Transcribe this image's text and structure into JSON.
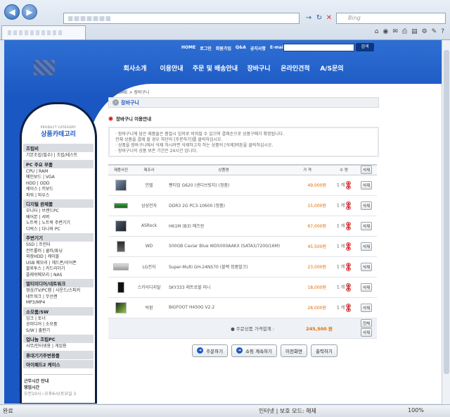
{
  "browser": {
    "search_placeholder": "Bing",
    "status_left": "완료",
    "status_zone": "인터넷 | 보호 모드: 해제",
    "zoom": "100%",
    "back_icon": "back-arrow-icon",
    "forward_icon": "forward-arrow-icon"
  },
  "site": {
    "top_links": [
      "HOME",
      "로그인",
      "회원가입",
      "Q&A",
      "공지사항",
      "E-mail"
    ],
    "search_button": "검색",
    "menu": [
      "회사소개",
      "이용안내",
      "주문 및 배송안내",
      "장바구니",
      "온라인견적",
      "A/S문의"
    ]
  },
  "sidebar": {
    "title_small": "PRODUCT CATEGORY",
    "title": "상품카테고리",
    "sections": [
      {
        "head": "조립비",
        "items": [
          "기본조립(필수) | 조립/테스트"
        ]
      },
      {
        "head": "PC 주요 부품",
        "items": [
          "CPU | RAM",
          "메인보드 | VGA",
          "HDD | ODD",
          "케이스 | 키보드",
          "파워 | 마우스"
        ]
      },
      {
        "head": "디지털 완제품",
        "items": [
          "모니터 | 브랜드PC",
          "베어본 | 서버",
          "노트북 | 노트북 주변기기",
          "디빅스 | 다나와 PC"
        ]
      },
      {
        "head": "주변기기",
        "items": [
          "SSD | 프린터",
          "컨트롤러 | 쿨러/튜닝",
          "외장HDD | 케이블",
          "USB 메모리 | 헤드폰/이어폰",
          "블루투스 | 카드리더기",
          "플레쉬메모리 | NAS"
        ]
      },
      {
        "head": "멀티미디어/네트워크",
        "items": [
          "영상/TV/PC캠 | 사운드/스피커",
          "네트워크 | 무선랜",
          "MP3/MP4"
        ]
      },
      {
        "head": "소모품/SW",
        "items": [
          "잉크 | 토너",
          "공미디어 | 소모품",
          "S/W | 출판기"
        ]
      },
      {
        "head": "업나눔 조립PC",
        "items": [
          "사무/인터넷용 | 게임용"
        ]
      },
      {
        "head": "휴대기기주변용품",
        "items": []
      },
      {
        "head": "아이패드2 케이스",
        "items": []
      }
    ],
    "hours_title": "근무시간 안내",
    "hours_sub": "영업시간",
    "hours_time": "오전10시~오후6시(토요일 3"
  },
  "main": {
    "breadcrumb": "• HOME > 장바구니",
    "page_title": "장바구니",
    "guide_title": "장바구니 이용안내",
    "guide_lines": [
      "· 장바구니에 담은 제품들은 품절시 임의로 비워질 수 있으며 결제순으로 상품구매가 확정됩니다.",
      "  전체 상품을 결제 할 경우 하단의 [주문하기]를 클릭하십시오.",
      "· 상품을 장바구니에서 삭제 하시려면 삭제하고자 하는 상품의 [삭제]버튼을 클릭하십시오.",
      "· 장바구니의 상품 보존 기간은 24시간 입니다."
    ],
    "table_headers": [
      "제품사진",
      "제조사",
      "상품명",
      "가 격",
      "수 량",
      "삭제"
    ],
    "rows": [
      {
        "maker": "인텔",
        "name": "펜티엄 G620 (샌디브릿지) (정품)",
        "price": "49,000원",
        "qty": "1 개",
        "thumb": "cpu"
      },
      {
        "maker": "삼성전자",
        "name": "DDR3 2G PC3-10600 (정품)",
        "price": "15,000원",
        "qty": "1 개",
        "thumb": "ram"
      },
      {
        "maker": "ASRock",
        "name": "H61M (B3) 에즈윈",
        "price": "67,000원",
        "qty": "1 개",
        "thumb": "board"
      },
      {
        "maker": "WD",
        "name": "500GB Caviar Blue WD5000AAKX (SATA3/7200/16M)",
        "price": "45,500원",
        "qty": "1 개",
        "thumb": "hdd"
      },
      {
        "maker": "LG전자",
        "name": "Super-Multi GH-24NS70 (블랙 정품벌크)",
        "price": "23,000원",
        "qty": "1 개",
        "thumb": "odd"
      },
      {
        "maker": "스카이디지탈",
        "name": "SKY333 레트로블 미니",
        "price": "18,000원",
        "qty": "1 개",
        "thumb": "mp3"
      },
      {
        "maker": "빅팜",
        "name": "BIGFOOT H450G V2.2",
        "price": "28,000원",
        "qty": "1 개",
        "thumb": "case"
      }
    ],
    "delete_label": "삭제",
    "total_label": "주문상품 가격합계 :",
    "total_value": "245,500 원",
    "total_btn_1": "전체",
    "total_btn_2": "삭제",
    "actions": [
      "주문하기",
      "쇼핑 계속하기",
      "이전화면",
      "출력하기"
    ]
  }
}
